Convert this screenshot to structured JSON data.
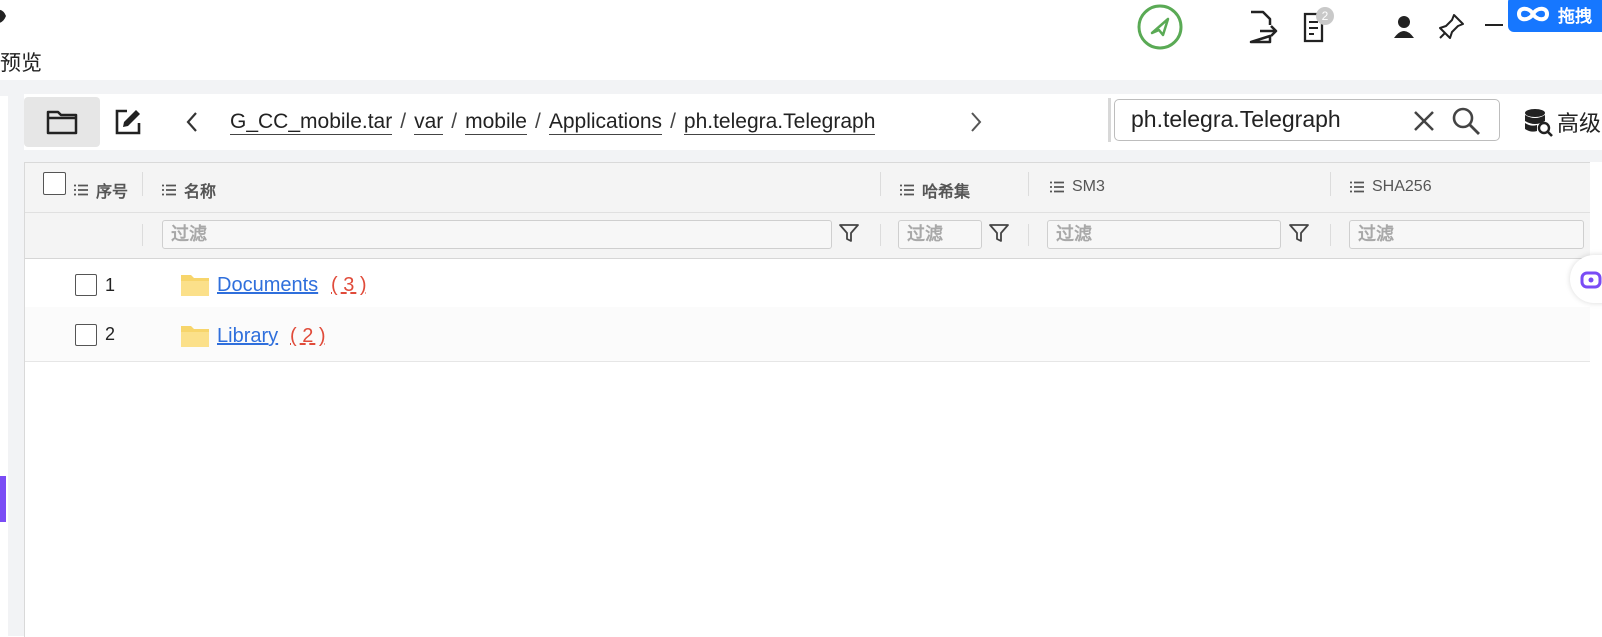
{
  "top": {
    "preview_label": "预览",
    "badge_count": "2",
    "blue_button_label": "拖拽"
  },
  "toolbar": {
    "breadcrumb": [
      "G_CC_mobile.tar",
      "var",
      "mobile",
      "Applications",
      "ph.telegra.Telegraph"
    ],
    "separator": "/",
    "search_value": "ph.telegra.Telegraph",
    "advanced_label": "高级"
  },
  "table": {
    "columns": {
      "index": "序号",
      "name": "名称",
      "hashset": "哈希集",
      "sm3": "SM3",
      "sha256": "SHA256"
    },
    "filter_placeholder": "过滤",
    "rows": [
      {
        "index": "1",
        "name": "Documents",
        "count": "( 3 )"
      },
      {
        "index": "2",
        "name": "Library",
        "count": "( 2 )"
      }
    ]
  },
  "colors": {
    "accent": "#7a4cf5",
    "link": "#2f6fdc",
    "count": "#e04b3a",
    "folder": "#f7d56b",
    "rocket_ring": "#5aaa55",
    "brand_blue": "#1677ff"
  }
}
